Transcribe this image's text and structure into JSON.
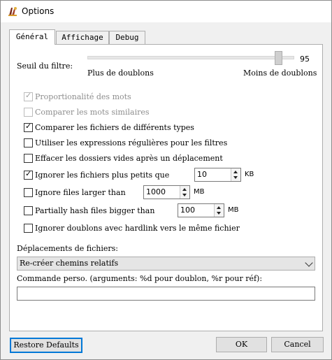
{
  "window": {
    "title": "Options"
  },
  "tabs": [
    {
      "label": "Général",
      "active": true
    },
    {
      "label": "Affichage",
      "active": false
    },
    {
      "label": "Debug",
      "active": false
    }
  ],
  "filter": {
    "label": "Seuil du filtre:",
    "value": "95",
    "slider_fraction": 0.95,
    "min_label": "Plus de doublons",
    "max_label": "Moins de doublons"
  },
  "options": [
    {
      "label": "Proportionalité des mots",
      "checked": true,
      "enabled": false
    },
    {
      "label": "Comparer les mots similaires",
      "checked": false,
      "enabled": false
    },
    {
      "label": "Comparer les fichiers de différents types",
      "checked": true,
      "enabled": true
    },
    {
      "label": "Utiliser les expressions régulières pour les filtres",
      "checked": false,
      "enabled": true
    },
    {
      "label": "Effacer les dossiers vides après un déplacement",
      "checked": false,
      "enabled": true
    },
    {
      "label": "Ignorer les fichiers plus petits que",
      "checked": true,
      "enabled": true,
      "value": "10",
      "unit": "KB"
    },
    {
      "label": "Ignore files larger than",
      "checked": false,
      "enabled": true,
      "value": "1000",
      "unit": "MB"
    },
    {
      "label": "Partially hash files bigger than",
      "checked": false,
      "enabled": true,
      "value": "100",
      "unit": "MB"
    },
    {
      "label": "Ignorer doublons avec hardlink vers le même fichier",
      "checked": false,
      "enabled": true
    }
  ],
  "moves": {
    "label": "Déplacements de fichiers:",
    "selected": "Re-créer chemins relatifs"
  },
  "custom_command": {
    "label": "Commande perso. (arguments: %d pour doublon, %r pour réf):",
    "value": ""
  },
  "buttons": {
    "restore": "Restore Defaults",
    "ok": "OK",
    "cancel": "Cancel"
  }
}
